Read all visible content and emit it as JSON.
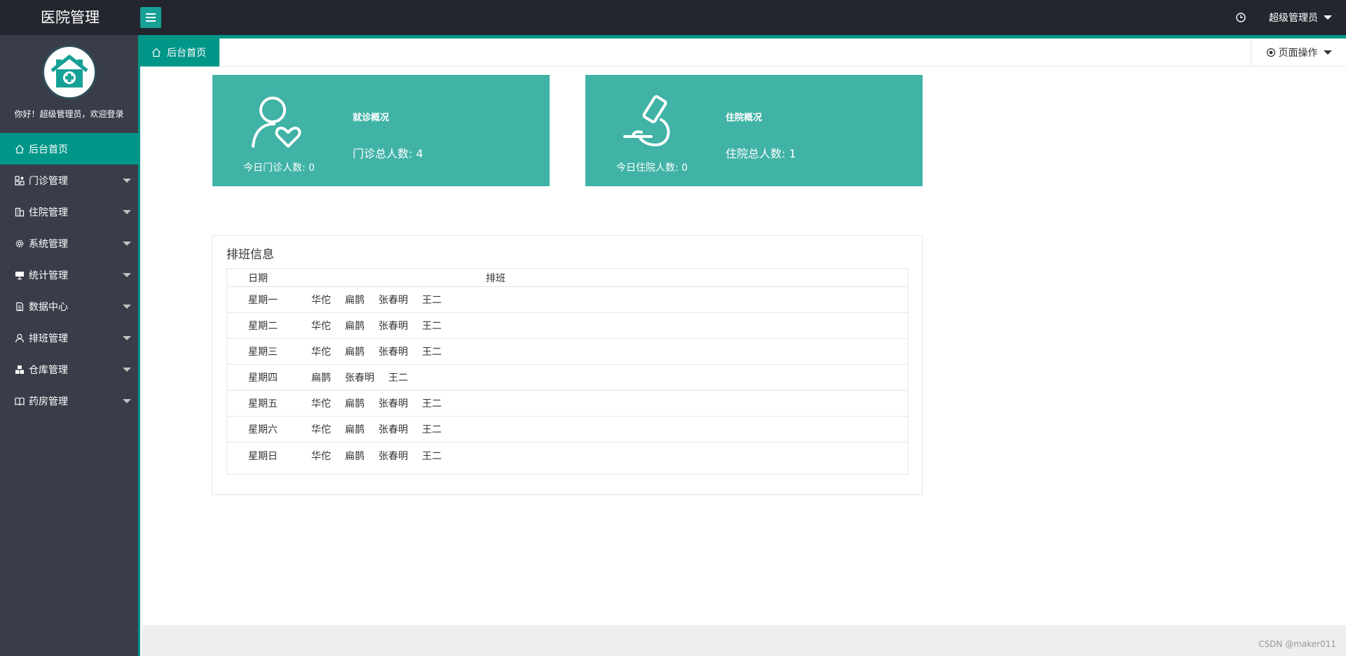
{
  "app": {
    "title": "医院管理"
  },
  "header": {
    "user_label": "超级管理员"
  },
  "sidebar": {
    "welcome": "你好！超级管理员，欢迎登录",
    "items": [
      {
        "label": "后台首页",
        "icon": "home-icon",
        "active": true
      },
      {
        "label": "门诊管理",
        "icon": "apps-icon"
      },
      {
        "label": "住院管理",
        "icon": "building-icon"
      },
      {
        "label": "系统管理",
        "icon": "gear-icon"
      },
      {
        "label": "统计管理",
        "icon": "monitor-icon"
      },
      {
        "label": "数据中心",
        "icon": "document-icon"
      },
      {
        "label": "排班管理",
        "icon": "user-icon"
      },
      {
        "label": "仓库管理",
        "icon": "boxes-icon"
      },
      {
        "label": "药房管理",
        "icon": "book-icon"
      }
    ]
  },
  "tabs": {
    "home_label": "后台首页",
    "page_ops_label": "页面操作"
  },
  "cards": {
    "outpatient": {
      "title": "就诊概况",
      "today": "今日门诊人数: 0",
      "total": "门诊总人数: 4"
    },
    "inpatient": {
      "title": "住院概况",
      "today": "今日住院人数: 0",
      "total": "住院总人数: 1"
    }
  },
  "schedule": {
    "title": "排班信息",
    "col_date": "日期",
    "col_shift": "排班",
    "rows": [
      {
        "day": "星期一",
        "doctors": [
          "华佗",
          "扁鹊",
          "张春明",
          "王二"
        ]
      },
      {
        "day": "星期二",
        "doctors": [
          "华佗",
          "扁鹊",
          "张春明",
          "王二"
        ]
      },
      {
        "day": "星期三",
        "doctors": [
          "华佗",
          "扁鹊",
          "张春明",
          "王二"
        ]
      },
      {
        "day": "星期四",
        "doctors": [
          "扁鹊",
          "张春明",
          "王二"
        ]
      },
      {
        "day": "星期五",
        "doctors": [
          "华佗",
          "扁鹊",
          "张春明",
          "王二"
        ]
      },
      {
        "day": "星期六",
        "doctors": [
          "华佗",
          "扁鹊",
          "张春明",
          "王二"
        ]
      },
      {
        "day": "星期日",
        "doctors": [
          "华佗",
          "扁鹊",
          "张春明",
          "王二"
        ]
      }
    ]
  },
  "footer": {
    "credit": "CSDN @maker011"
  },
  "colors": {
    "accent": "#009688",
    "card": "#40b2a6",
    "sidebar": "#393d49",
    "topbar": "#23262e"
  }
}
